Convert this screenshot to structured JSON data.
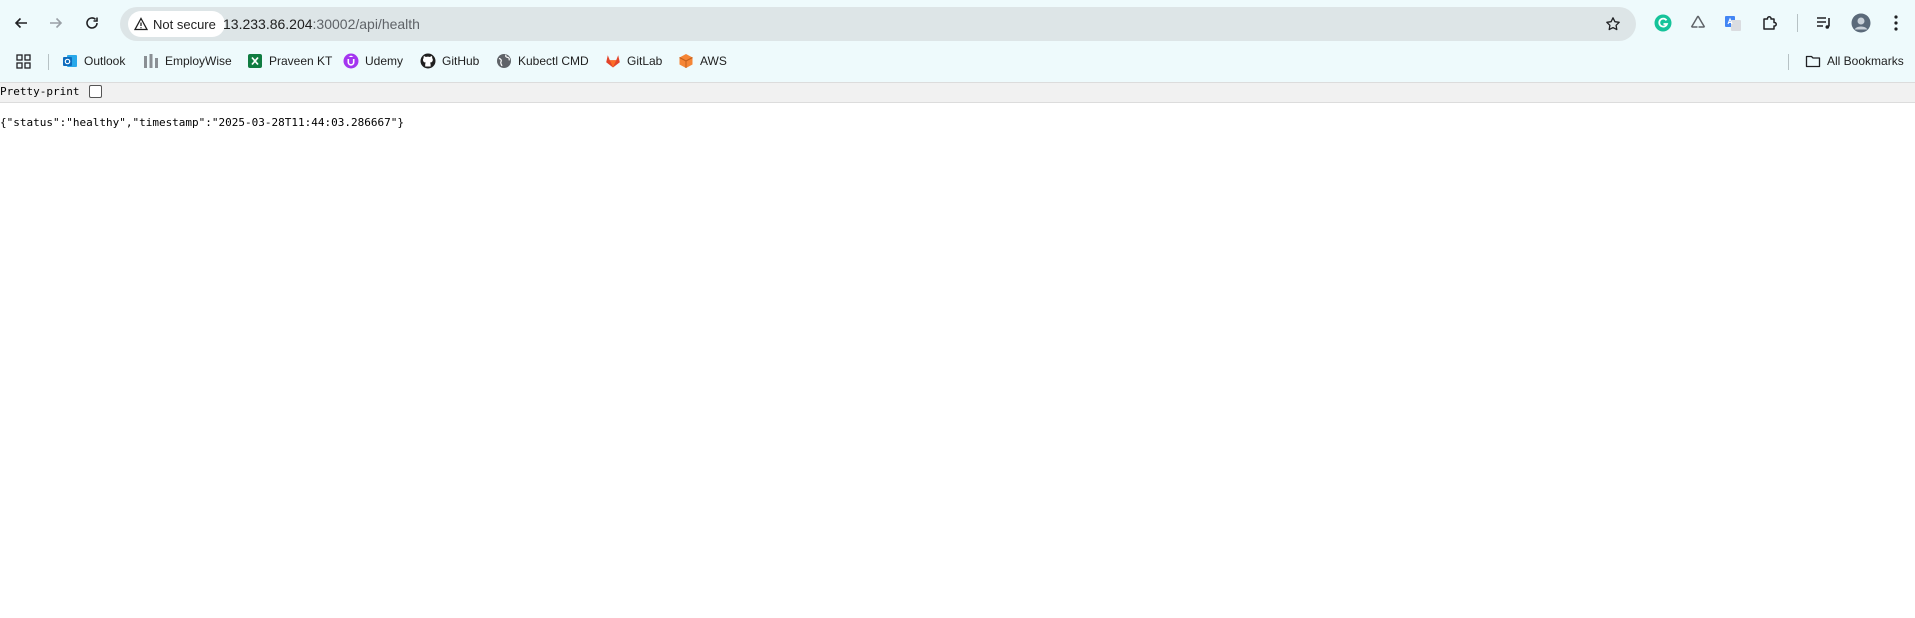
{
  "browser": {
    "security_label": "Not secure",
    "url_host": "13.233.86.204",
    "url_rest": ":30002/api/health"
  },
  "bookmarks": {
    "items": [
      {
        "label": "Outlook",
        "icon": "outlook-icon"
      },
      {
        "label": "EmployWise",
        "icon": "employwise-icon"
      },
      {
        "label": "Praveen KT",
        "icon": "excel-icon"
      },
      {
        "label": "Udemy",
        "icon": "udemy-icon"
      },
      {
        "label": "GitHub",
        "icon": "github-icon"
      },
      {
        "label": "Kubectl CMD",
        "icon": "globe-icon"
      },
      {
        "label": "GitLab",
        "icon": "gitlab-icon"
      },
      {
        "label": "AWS",
        "icon": "aws-icon"
      }
    ],
    "all_bookmarks_label": "All Bookmarks"
  },
  "viewer": {
    "pretty_print_label": "Pretty-print",
    "pretty_print_checked": false,
    "json_text": "{\"status\":\"healthy\",\"timestamp\":\"2025-03-28T11:44:03.286667\"}"
  },
  "colors": {
    "chrome_background": "#eefafc",
    "omnibox_background": "#dde5e7",
    "grammarly": "#15c39a",
    "gitlab": "#e24329",
    "aws": "#f58536",
    "udemy": "#a435f0",
    "outlook": "#0f6cbd",
    "excel": "#107c41"
  }
}
